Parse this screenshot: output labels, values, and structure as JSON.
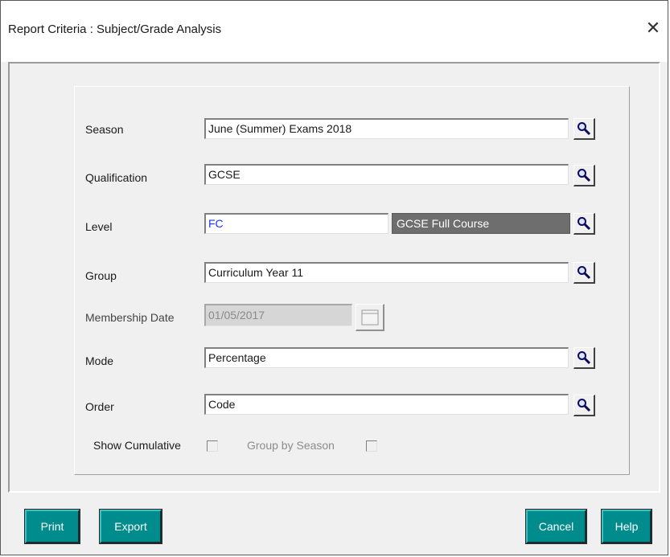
{
  "window": {
    "title": "Report Criteria : Subject/Grade Analysis",
    "close_glyph": "✕"
  },
  "form": {
    "season": {
      "label": "Season",
      "value": "June (Summer) Exams 2018"
    },
    "qualification": {
      "label": "Qualification",
      "value": "GCSE"
    },
    "level": {
      "label": "Level",
      "code": "FC",
      "description": "GCSE Full Course"
    },
    "group": {
      "label": "Group",
      "value": "Curriculum Year 11"
    },
    "membership_date": {
      "label": "Membership Date",
      "value": "01/05/2017",
      "enabled": false
    },
    "mode": {
      "label": "Mode",
      "value": "Percentage"
    },
    "order": {
      "label": "Order",
      "value": "Code"
    },
    "show_cumulative": {
      "label": "Show Cumulative",
      "checked": false
    },
    "group_by_season": {
      "label": "Group by Season",
      "checked": false,
      "enabled": false
    }
  },
  "buttons": {
    "print": "Print",
    "export": "Export",
    "cancel": "Cancel",
    "help": "Help"
  },
  "colors": {
    "button_bg": "#008c8c",
    "level_desc_bg": "#6e6e6e",
    "level_code_text": "#1a33ff"
  },
  "icons": {
    "lookup": "magnifier-icon",
    "calendar": "calendar-icon"
  }
}
